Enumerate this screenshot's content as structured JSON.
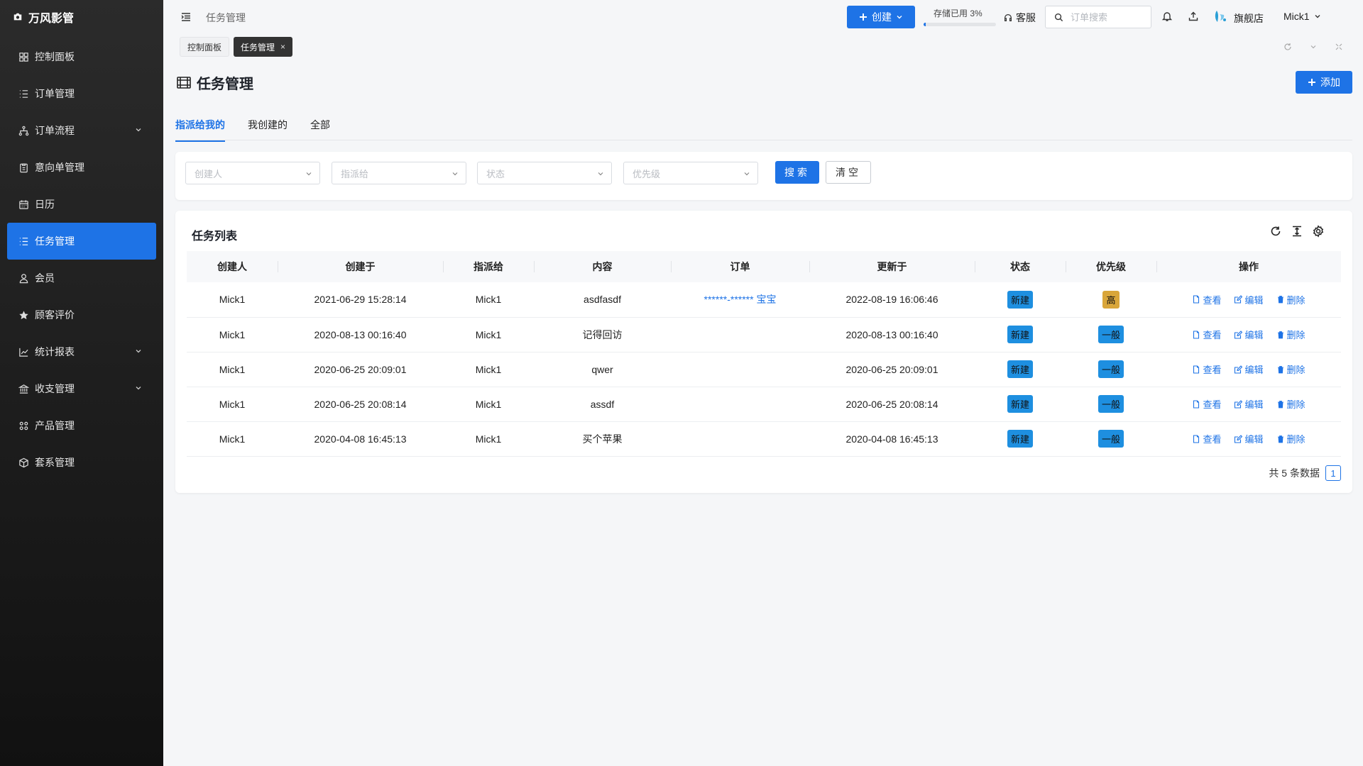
{
  "app": {
    "name": "万风影管"
  },
  "sidebar": {
    "items": [
      {
        "label": "控制面板",
        "icon": "dashboard-icon"
      },
      {
        "label": "订单管理",
        "icon": "list-icon"
      },
      {
        "label": "订单流程",
        "icon": "flow-icon"
      },
      {
        "label": "意向单管理",
        "icon": "clipboard-icon"
      },
      {
        "label": "日历",
        "icon": "calendar-icon"
      },
      {
        "label": "任务管理",
        "icon": "tasks-icon"
      },
      {
        "label": "会员",
        "icon": "user-icon"
      },
      {
        "label": "顾客评价",
        "icon": "star-icon"
      },
      {
        "label": "统计报表",
        "icon": "chart-icon"
      },
      {
        "label": "收支管理",
        "icon": "bank-icon"
      },
      {
        "label": "产品管理",
        "icon": "grid-icon"
      },
      {
        "label": "套系管理",
        "icon": "box-icon"
      }
    ]
  },
  "header": {
    "breadcrumb": "任务管理",
    "create_label": "创建",
    "storage_label": "存储已用 3%",
    "storage_percent": 3,
    "support_label": "客服",
    "search_placeholder": "订单搜索",
    "store_name": "旗舰店",
    "user_name": "Mick1"
  },
  "tags": {
    "dashboard": "控制面板",
    "current": "任务管理",
    "close": "×"
  },
  "page": {
    "title": "任务管理",
    "add_label": "添加"
  },
  "filter_tabs": {
    "assigned": "指派给我的",
    "created": "我创建的",
    "all": "全部"
  },
  "filters": {
    "creator": "创建人",
    "assignee": "指派给",
    "status": "状态",
    "priority": "优先级",
    "search_label": "搜索",
    "clear_label": "清空"
  },
  "table": {
    "title": "任务列表",
    "columns": {
      "creator": "创建人",
      "created_at": "创建于",
      "assignee": "指派给",
      "content": "内容",
      "order": "订单",
      "updated_at": "更新于",
      "status": "状态",
      "priority": "优先级",
      "actions": "操作"
    },
    "actions": {
      "view": "查看",
      "edit": "编辑",
      "delete": "删除"
    },
    "rows": [
      {
        "creator": "Mick1",
        "created_at": "2021-06-29 15:28:14",
        "assignee": "Mick1",
        "content": "asdfasdf",
        "order": "******-****** 宝宝",
        "updated_at": "2022-08-19 16:06:46",
        "status": "新建",
        "priority": "高"
      },
      {
        "creator": "Mick1",
        "created_at": "2020-08-13 00:16:40",
        "assignee": "Mick1",
        "content": "记得回访",
        "order": "",
        "updated_at": "2020-08-13 00:16:40",
        "status": "新建",
        "priority": "一般"
      },
      {
        "creator": "Mick1",
        "created_at": "2020-06-25 20:09:01",
        "assignee": "Mick1",
        "content": "qwer",
        "order": "",
        "updated_at": "2020-06-25 20:09:01",
        "status": "新建",
        "priority": "一般"
      },
      {
        "creator": "Mick1",
        "created_at": "2020-06-25 20:08:14",
        "assignee": "Mick1",
        "content": "assdf",
        "order": "",
        "updated_at": "2020-06-25 20:08:14",
        "status": "新建",
        "priority": "一般"
      },
      {
        "creator": "Mick1",
        "created_at": "2020-04-08 16:45:13",
        "assignee": "Mick1",
        "content": "买个苹果",
        "order": "",
        "updated_at": "2020-04-08 16:45:13",
        "status": "新建",
        "priority": "一般"
      }
    ],
    "total_label": "共 5 条数据",
    "current_page": "1"
  },
  "colors": {
    "primary": "#1e73e6",
    "badge_blue": "#1e8fe0",
    "badge_high": "#d9a63a"
  }
}
